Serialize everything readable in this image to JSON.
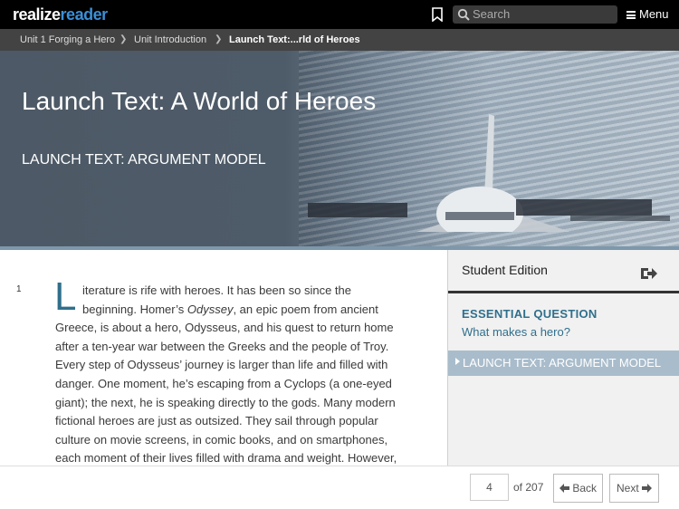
{
  "topbar": {
    "logo_part1": "realize",
    "logo_part2": "reader",
    "search_placeholder": "Search",
    "menu_label": "Menu"
  },
  "breadcrumb": {
    "items": [
      "Unit 1 Forging a Hero",
      "Unit Introduction",
      "Launch Text:...rld of Heroes"
    ]
  },
  "hero": {
    "title": "Launch Text: A World of Heroes",
    "subtitle": "LAUNCH TEXT: ARGUMENT MODEL"
  },
  "reading": {
    "line_number": "1",
    "drop_cap": "L",
    "lines": [
      "iterature is rife with heroes. It has been so since the",
      "beginning. Homer’s ",
      "Odyssey",
      ", an epic poem from ancient",
      "Greece, is about a hero, Odysseus, and his quest to return home",
      "after a ten-year war between the Greeks and the people of Troy.",
      "Every step of Odysseus’ journey is larger than life and filled with",
      "danger. One moment, he’s escaping from a Cyclops (a one-eyed",
      "giant); the next, he is speaking directly to the gods. Many modern",
      "fictional heroes are just as outsized. They sail through popular",
      "culture on movie screens, in comic books, and on smartphones,",
      "each moment of their lives filled with drama and weight. However,"
    ]
  },
  "panel": {
    "title": "Student Edition",
    "eq_label": "ESSENTIAL QUESTION",
    "eq_text": "What makes a hero?",
    "toc_item": "LAUNCH TEXT: ARGUMENT MODEL"
  },
  "footer": {
    "page_value": "4",
    "of_label": "of 207",
    "back_label": "Back",
    "next_label": "Next"
  },
  "colors": {
    "accent": "#2f6f8c",
    "toc_bg": "#a9bccb",
    "logo_blue": "#3a8fd8"
  }
}
